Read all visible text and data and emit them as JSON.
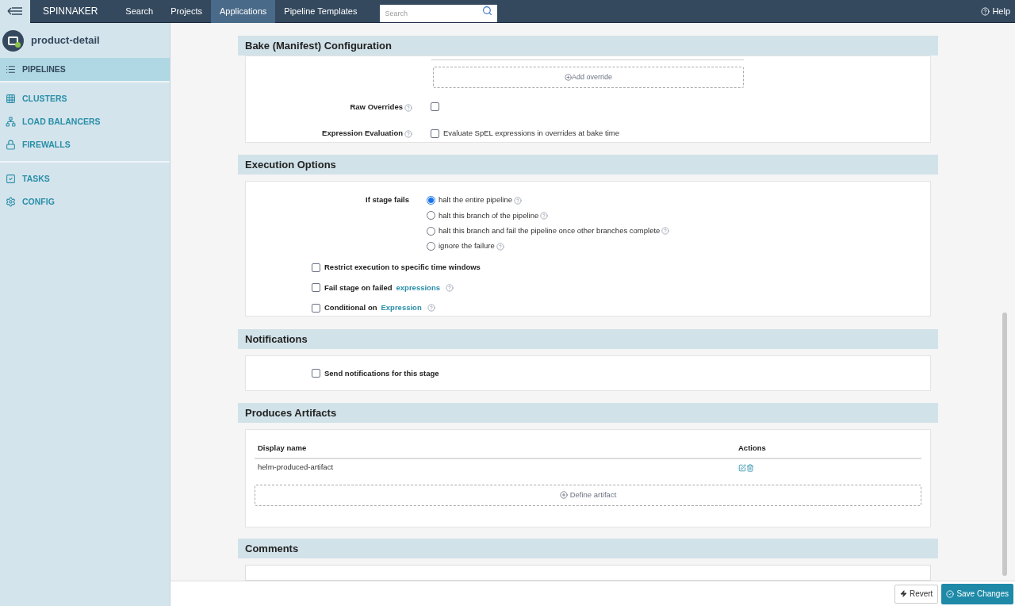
{
  "nav": {
    "brand": "SPINNAKER",
    "links": [
      {
        "label": "Search",
        "selected": false
      },
      {
        "label": "Projects",
        "selected": false
      },
      {
        "label": "Applications",
        "selected": true
      },
      {
        "label": "Pipeline Templates",
        "selected": false
      }
    ],
    "search": {
      "placeholder": "Search"
    },
    "help": "Help"
  },
  "sidebar": {
    "app_name": "product-detail",
    "groups": [
      [
        {
          "kind": "pipelines",
          "label": "PIPELINES",
          "selected": true
        }
      ],
      [
        {
          "kind": "clusters",
          "label": "CLUSTERS",
          "selected": false
        },
        {
          "kind": "load_balancers",
          "label": "LOAD BALANCERS",
          "selected": false
        },
        {
          "kind": "firewalls",
          "label": "FIREWALLS",
          "selected": false
        }
      ],
      [
        {
          "kind": "tasks",
          "label": "TASKS",
          "selected": false
        },
        {
          "kind": "config",
          "label": "CONFIG",
          "selected": false
        }
      ]
    ]
  },
  "bake": {
    "title": "Bake (Manifest) Configuration",
    "add_override": "Add override",
    "raw_overrides": {
      "label": "Raw Overrides",
      "checked": false
    },
    "expression_evaluation": {
      "label": "Expression Evaluation",
      "checked": false,
      "text": "Evaluate SpEL expressions in overrides at bake time"
    }
  },
  "execution": {
    "title": "Execution Options",
    "fail_label": "If stage fails",
    "fail_options": [
      {
        "label": "halt the entire pipeline",
        "selected": true
      },
      {
        "label": "halt this branch of the pipeline",
        "selected": false
      },
      {
        "label": "halt this branch and fail the pipeline once other branches complete",
        "selected": false
      },
      {
        "label": "ignore the failure",
        "selected": false
      }
    ],
    "checks": [
      {
        "label": "Restrict execution to specific time windows",
        "checked": false
      },
      {
        "label": "Fail stage on failed",
        "link": "expressions",
        "checked": false
      },
      {
        "label": "Conditional on",
        "link": "Expression",
        "checked": false
      }
    ]
  },
  "notifications": {
    "title": "Notifications",
    "check": {
      "label": "Send notifications for this stage",
      "checked": false
    }
  },
  "artifacts": {
    "title": "Produces Artifacts",
    "columns": [
      "Display name",
      "Actions"
    ],
    "rows": [
      {
        "name": "helm-produced-artifact"
      }
    ],
    "define": "Define artifact"
  },
  "comments": {
    "title": "Comments"
  },
  "footer": {
    "revert": "Revert",
    "save": "Save Changes"
  }
}
